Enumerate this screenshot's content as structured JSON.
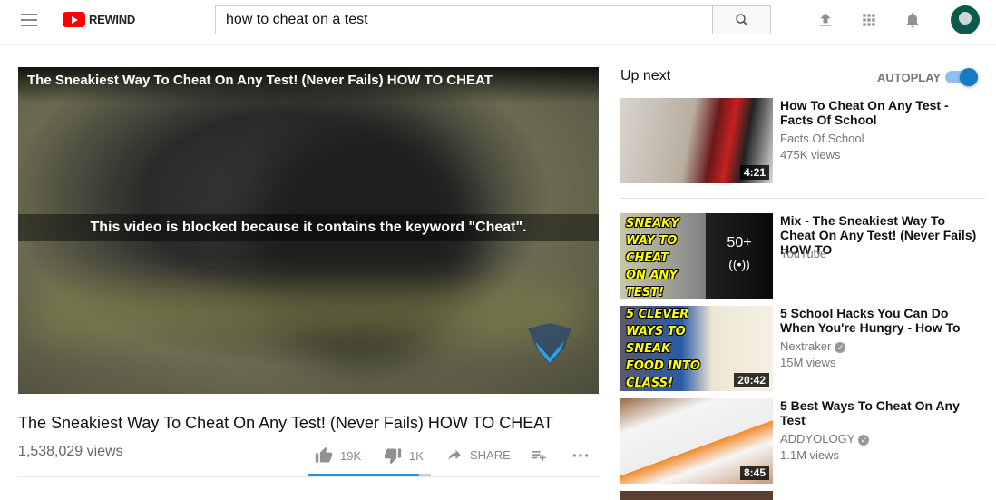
{
  "header": {
    "logo_text": "REWIND",
    "search_value": "how to cheat on a test",
    "icons": [
      "menu-icon",
      "upload-icon",
      "apps-icon",
      "bell-icon",
      "avatar"
    ]
  },
  "player": {
    "overlay_title": "The Sneakiest Way To Cheat On Any Test! (Never Fails) HOW TO CHEAT",
    "blocked_message": "This video is blocked because it contains the keyword \"Cheat\"."
  },
  "video": {
    "title": "The Sneakiest Way To Cheat On Any Test! (Never Fails) HOW TO CHEAT",
    "views": "1,538,029 views",
    "likes": "19K",
    "dislikes": "1K",
    "share": "SHARE",
    "like_ratio": 0.9
  },
  "sidebar": {
    "up_next": "Up next",
    "autoplay": "AUTOPLAY",
    "autoplay_on": true,
    "items": [
      {
        "title": "How To Cheat On Any Test - Facts Of School",
        "channel": "Facts Of School",
        "views": "475K views",
        "duration": "4:21",
        "verified": false
      },
      {
        "title": "Mix - The Sneakiest Way To Cheat On Any Test! (Never Fails) HOW TO",
        "channel": "YouTube",
        "count": "50+",
        "thumb_text": "SNEAKY WAY TO CHEAT ON ANY TEST!"
      },
      {
        "title": "5 School Hacks You Can Do When You're Hungry - How To",
        "channel": "Nextraker",
        "views": "15M views",
        "duration": "20:42",
        "verified": true,
        "thumb_text": "5 CLEVER WAYS TO SNEAK FOOD INTO CLASS!"
      },
      {
        "title": "5 Best Ways To Cheat On Any Test",
        "channel": "ADDYOLOGY",
        "views": "1.1M views",
        "duration": "8:45",
        "verified": true
      }
    ]
  },
  "colors": {
    "accent": "#167ac6",
    "brand": "#ff0000",
    "like_bar": "#2793e6"
  }
}
